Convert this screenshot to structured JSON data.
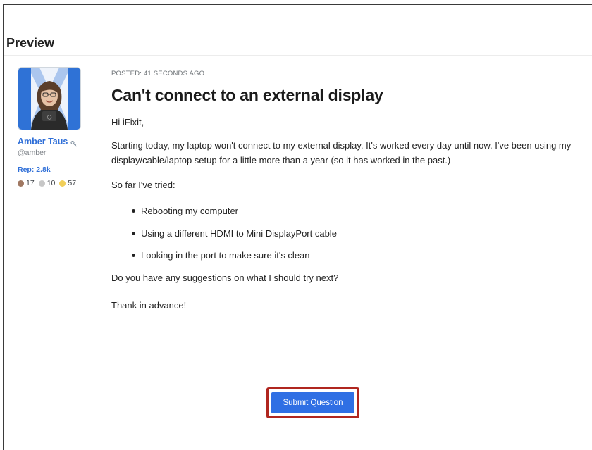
{
  "preview": {
    "title": "Preview"
  },
  "author": {
    "name": "Amber Taus",
    "handle": "@amber",
    "reputation": "Rep: 2.8k",
    "badges": [
      {
        "color": "#a07862",
        "count": "17"
      },
      {
        "color": "#c7c7c7",
        "count": "10"
      },
      {
        "color": "#f1cf5a",
        "count": "57"
      }
    ]
  },
  "question": {
    "posted": "POSTED: 41 SECONDS AGO",
    "title": "Can't connect to an external display",
    "greeting": "Hi iFixit,",
    "paragraph": "Starting today, my laptop won't connect to my external display. It's worked every day until now. I've been using my display/cable/laptop setup for a little more than a year (so it has worked in the past.)",
    "tried_intro": "So far I've tried:",
    "tried_items": [
      "Rebooting my computer",
      "Using a different HDMI to Mini DisplayPort cable",
      "Looking in the port to make sure it's clean"
    ],
    "ask": "Do you have any suggestions on what I should try next?",
    "thanks": "Thank in advance!"
  },
  "actions": {
    "submit_label": "Submit Question"
  },
  "colors": {
    "accent": "#2f6fe4",
    "highlight": "#b0261f",
    "link": "#2f6fd8"
  }
}
